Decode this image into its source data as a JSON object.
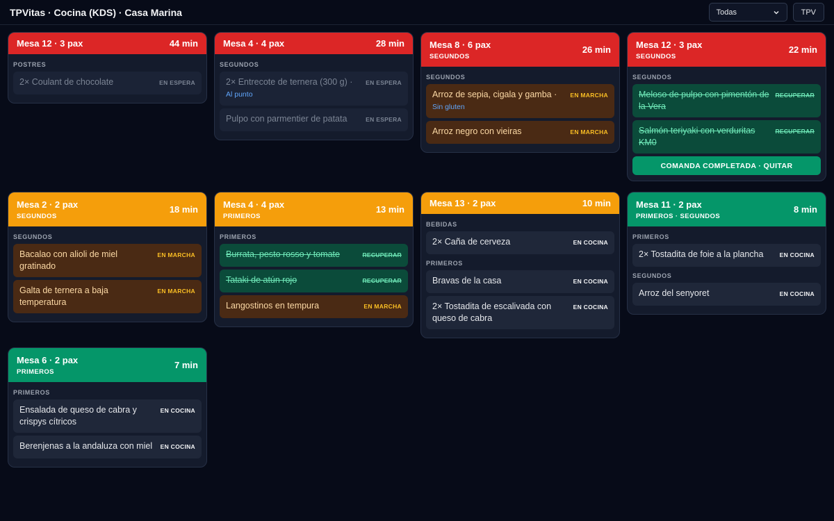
{
  "header": {
    "title": "TPVitas · Cocina (KDS) · Casa Marina",
    "filter_selected": "Todas",
    "tpv_label": "TPV"
  },
  "colors": {
    "red": "#dc2626",
    "orange": "#f59e0b",
    "green": "#059669",
    "background": "#070b18"
  },
  "orders": [
    {
      "title": "Mesa 12 · 3 pax",
      "subtitle": "",
      "time": "44 min",
      "color": "red",
      "sections": [
        {
          "label": "POSTRES",
          "items": [
            {
              "text": "2× Coulant de chocolate",
              "note": "",
              "status": "EN ESPERA",
              "state": "espera"
            }
          ]
        }
      ]
    },
    {
      "title": "Mesa 4 · 4 pax",
      "subtitle": "",
      "time": "28 min",
      "color": "red",
      "sections": [
        {
          "label": "SEGUNDOS",
          "items": [
            {
              "text": "2× Entrecote de ternera (300 g) ·",
              "note": "Al punto",
              "status": "EN ESPERA",
              "state": "espera"
            },
            {
              "text": "Pulpo con parmentier de patata",
              "note": "",
              "status": "EN ESPERA",
              "state": "espera"
            }
          ]
        }
      ]
    },
    {
      "title": "Mesa 8 · 6 pax",
      "subtitle": "SEGUNDOS",
      "time": "26 min",
      "color": "red",
      "sections": [
        {
          "label": "SEGUNDOS",
          "items": [
            {
              "text": "Arroz de sepia, cigala y gamba ·",
              "note": "Sin gluten",
              "status": "EN MARCHA",
              "state": "marcha"
            },
            {
              "text": "Arroz negro con vieiras",
              "note": "",
              "status": "EN MARCHA",
              "state": "marcha"
            }
          ]
        }
      ]
    },
    {
      "title": "Mesa 12 · 3 pax",
      "subtitle": "SEGUNDOS",
      "time": "22 min",
      "color": "red",
      "complete_label": "COMANDA COMPLETADA · QUITAR",
      "sections": [
        {
          "label": "SEGUNDOS",
          "items": [
            {
              "text": "Meloso de pulpo con pimentón de la Vera",
              "note": "",
              "status": "RECUPERAR",
              "state": "done"
            },
            {
              "text": "Salmón teriyaki con verduritas KM0",
              "note": "",
              "status": "RECUPERAR",
              "state": "done"
            }
          ]
        }
      ]
    },
    {
      "title": "Mesa 2 · 2 pax",
      "subtitle": "SEGUNDOS",
      "time": "18 min",
      "color": "orange",
      "sections": [
        {
          "label": "SEGUNDOS",
          "items": [
            {
              "text": "Bacalao con alioli de miel gratinado",
              "note": "",
              "status": "EN MARCHA",
              "state": "marcha"
            },
            {
              "text": "Galta de ternera a baja temperatura",
              "note": "",
              "status": "EN MARCHA",
              "state": "marcha"
            }
          ]
        }
      ]
    },
    {
      "title": "Mesa 4 · 4 pax",
      "subtitle": "PRIMEROS",
      "time": "13 min",
      "color": "orange",
      "sections": [
        {
          "label": "PRIMEROS",
          "items": [
            {
              "text": "Burrata, pesto rosso y tomate",
              "note": "",
              "status": "RECUPERAR",
              "state": "done"
            },
            {
              "text": "Tataki de atún rojo",
              "note": "",
              "status": "RECUPERAR",
              "state": "done"
            },
            {
              "text": "Langostinos en tempura",
              "note": "",
              "status": "EN MARCHA",
              "state": "marcha"
            }
          ]
        }
      ]
    },
    {
      "title": "Mesa 13 · 2 pax",
      "subtitle": "",
      "time": "10 min",
      "color": "orange",
      "sections": [
        {
          "label": "BEBIDAS",
          "items": [
            {
              "text": "2× Caña de cerveza",
              "note": "",
              "status": "EN COCINA",
              "state": "cocina"
            }
          ]
        },
        {
          "label": "PRIMEROS",
          "items": [
            {
              "text": "Bravas de la casa",
              "note": "",
              "status": "EN COCINA",
              "state": "cocina"
            },
            {
              "text": "2× Tostadita de escalivada con queso de cabra",
              "note": "",
              "status": "EN COCINA",
              "state": "cocina"
            }
          ]
        }
      ]
    },
    {
      "title": "Mesa 11 · 2 pax",
      "subtitle": "PRIMEROS · SEGUNDOS",
      "time": "8 min",
      "color": "green",
      "sections": [
        {
          "label": "PRIMEROS",
          "items": [
            {
              "text": "2× Tostadita de foie a la plancha",
              "note": "",
              "status": "EN COCINA",
              "state": "cocina"
            }
          ]
        },
        {
          "label": "SEGUNDOS",
          "items": [
            {
              "text": "Arroz del senyoret",
              "note": "",
              "status": "EN COCINA",
              "state": "cocina"
            }
          ]
        }
      ]
    },
    {
      "title": "Mesa 6 · 2 pax",
      "subtitle": "PRIMEROS",
      "time": "7 min",
      "color": "green",
      "sections": [
        {
          "label": "PRIMEROS",
          "items": [
            {
              "text": "Ensalada de queso de cabra y crispys cítricos",
              "note": "",
              "status": "EN COCINA",
              "state": "cocina"
            },
            {
              "text": "Berenjenas a la andaluza con miel",
              "note": "",
              "status": "EN COCINA",
              "state": "cocina"
            }
          ]
        }
      ]
    }
  ]
}
